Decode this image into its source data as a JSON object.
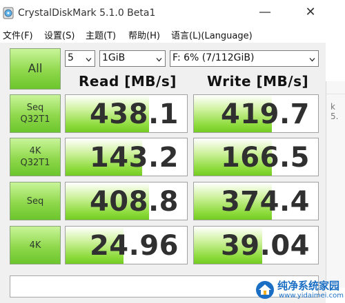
{
  "window": {
    "title": "CrystalDiskMark 5.1.0 Beta1",
    "minimize_glyph": "—",
    "close_glyph": "✕"
  },
  "menu": [
    {
      "label": "文件(F)"
    },
    {
      "label": "设置(S)"
    },
    {
      "label": "主题(T)"
    },
    {
      "label": "帮助(H)"
    },
    {
      "label": "语言(L)(Language)"
    }
  ],
  "controls": {
    "all_label": "All",
    "count": "5",
    "size": "1GiB",
    "drive": "F: 6% (7/112GiB)"
  },
  "headers": {
    "read": "Read [MB/s]",
    "write": "Write [MB/s]"
  },
  "rows": [
    {
      "line1": "Seq",
      "line2": "Q32T1",
      "read": "438.1",
      "write": "419.7",
      "read_fill": 0.69,
      "write_fill": 0.63
    },
    {
      "line1": "4K",
      "line2": "Q32T1",
      "read": "143.2",
      "write": "166.5",
      "read_fill": 0.63,
      "write_fill": 0.63
    },
    {
      "line1": "Seq",
      "line2": "",
      "read": "408.8",
      "write": "374.4",
      "read_fill": 0.69,
      "write_fill": 0.63
    },
    {
      "line1": "4K",
      "line2": "",
      "read": "24.96",
      "write": "39.04",
      "read_fill": 0.48,
      "write_fill": 0.55
    }
  ],
  "comment": "",
  "background_window": {
    "text": "k 5."
  },
  "watermark": {
    "text": "纯净系统家园",
    "url": "www.yidaimei.com"
  },
  "colors": {
    "button_green": "#8fd84c",
    "bar_green": "#8fdc3e",
    "value_text": "#303030",
    "watermark_blue": "#1a6fc4"
  },
  "icons": {
    "app": "disk-icon",
    "dropdown": "chevron-down-icon",
    "watermark": "house-logo-icon"
  }
}
